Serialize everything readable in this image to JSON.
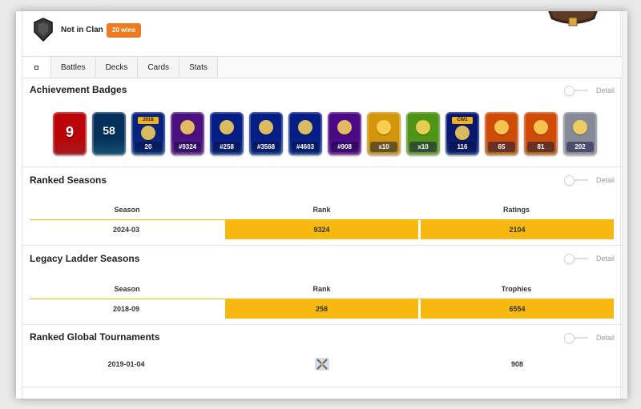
{
  "header": {
    "clan_status": "Not in Clan",
    "wins_badge": "20 wins"
  },
  "tabs": [
    {
      "label": ""
    },
    {
      "label": "Battles"
    },
    {
      "label": "Decks"
    },
    {
      "label": "Cards"
    },
    {
      "label": "Stats"
    }
  ],
  "detail_label": "Detail",
  "achievements": {
    "title": "Achievement Badges",
    "badges": [
      {
        "name": "ball-nine",
        "value": "9",
        "color": "#d9252a"
      },
      {
        "name": "level",
        "value": "58",
        "color": "#1f6f99"
      },
      {
        "name": "year-2018",
        "value": "20",
        "top": "2018",
        "color": "#2b5fb3"
      },
      {
        "name": "clan-wars",
        "value": "#9324",
        "color": "#8a3fb5"
      },
      {
        "name": "trophy-gold",
        "value": "#258",
        "color": "#2357b8"
      },
      {
        "name": "trophy-gold-2",
        "value": "#3568",
        "color": "#2357b8"
      },
      {
        "name": "trophy-gold-3",
        "value": "#4603",
        "color": "#2357b8"
      },
      {
        "name": "crown-purple",
        "value": "#908",
        "color": "#8b2fb8"
      },
      {
        "name": "sword-yellow",
        "value": "x10",
        "color": "#e8c333"
      },
      {
        "name": "sword-green",
        "value": "x10",
        "color": "#8bc34a"
      },
      {
        "name": "cw1",
        "value": "116",
        "top": "CW1",
        "color": "#2c4fa8"
      },
      {
        "name": "cards-orange",
        "value": "65",
        "color": "#e68a2e"
      },
      {
        "name": "crown-orange",
        "value": "81",
        "color": "#e68a2e"
      },
      {
        "name": "card-grey",
        "value": "202",
        "color": "#b9bcc4"
      }
    ]
  },
  "ranked_seasons": {
    "title": "Ranked Seasons",
    "columns": [
      "Season",
      "Rank",
      "Ratings"
    ],
    "rows": [
      [
        "2024-03",
        "9324",
        "2104"
      ]
    ]
  },
  "legacy_ladder": {
    "title": "Legacy Ladder Seasons",
    "columns": [
      "Season",
      "Rank",
      "Trophies"
    ],
    "rows": [
      [
        "2018-09",
        "258",
        "6554"
      ]
    ]
  },
  "global_tournaments": {
    "title": "Ranked Global Tournaments",
    "rows": [
      [
        "2019-01-04",
        "crossed-swords-icon",
        "908"
      ]
    ]
  },
  "colors": {
    "accent_orange": "#f07a20",
    "rank_highlight": "#f7b90f"
  }
}
